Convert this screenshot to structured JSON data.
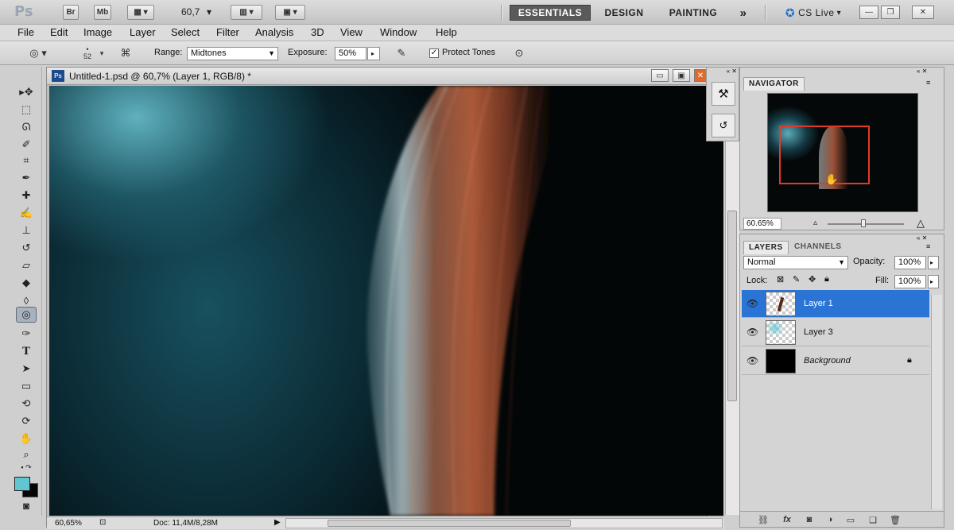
{
  "appbar": {
    "logo": "Ps",
    "bridge": "Br",
    "minibridge": "Mb",
    "zoom_value": "60,7",
    "workspaces": [
      "ESSENTIALS",
      "DESIGN",
      "PAINTING"
    ],
    "more": "»",
    "cs_live": "CS Live"
  },
  "menu": [
    "File",
    "Edit",
    "Image",
    "Layer",
    "Select",
    "Filter",
    "Analysis",
    "3D",
    "View",
    "Window",
    "Help"
  ],
  "options": {
    "brush_size": "52",
    "range_label": "Range:",
    "range_value": "Midtones",
    "exposure_label": "Exposure:",
    "exposure_value": "50%",
    "protect_tones_label": "Protect Tones",
    "protect_tones_checked": true
  },
  "document": {
    "title": "Untitled-1.psd @ 60,7% (Layer 1, RGB/8) *",
    "zoom": "60,65%",
    "doc_info": "Doc: 11,4M/8,28M"
  },
  "navigator": {
    "tab": "NAVIGATOR",
    "zoom": "60.65%"
  },
  "layers": {
    "tabs": [
      "LAYERS",
      "CHANNELS"
    ],
    "blend_mode": "Normal",
    "opacity_label": "Opacity:",
    "opacity_value": "100%",
    "lock_label": "Lock:",
    "fill_label": "Fill:",
    "fill_value": "100%",
    "items": [
      {
        "name": "Layer 1",
        "selected": true
      },
      {
        "name": "Layer 3",
        "selected": false
      },
      {
        "name": "Background",
        "selected": false,
        "locked": true
      }
    ]
  },
  "colors": {
    "foreground": "#5fc6d2",
    "background": "#050505",
    "selection": "#2a74d6"
  }
}
